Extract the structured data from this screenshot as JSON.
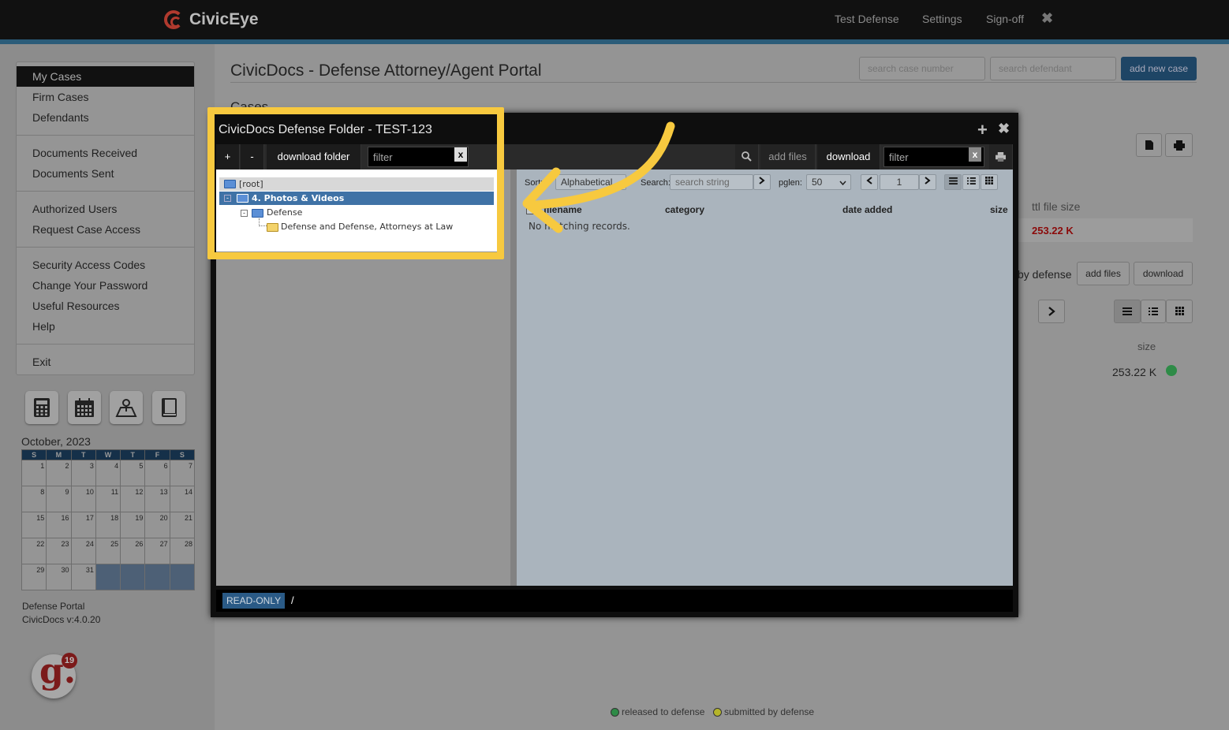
{
  "app": {
    "name": "CivicEye"
  },
  "topnav": {
    "items": [
      "Test Defense",
      "Settings",
      "Sign-off"
    ],
    "close": "✖"
  },
  "sidebar": {
    "items": [
      "My Cases",
      "Firm Cases",
      "Defendants",
      "Documents Received",
      "Documents Sent",
      "Authorized Users",
      "Request Case Access",
      "Security Access Codes",
      "Change Your Password",
      "Useful Resources",
      "Help",
      "Exit"
    ]
  },
  "calendar": {
    "title": "October, 2023",
    "days": [
      "S",
      "M",
      "T",
      "W",
      "T",
      "F",
      "S"
    ],
    "weeks": [
      [
        "1",
        "2",
        "3",
        "4",
        "5",
        "6",
        "7"
      ],
      [
        "8",
        "9",
        "10",
        "11",
        "12",
        "13",
        "14"
      ],
      [
        "15",
        "16",
        "17",
        "18",
        "19",
        "20",
        "21"
      ],
      [
        "22",
        "23",
        "24",
        "25",
        "26",
        "27",
        "28"
      ],
      [
        "29",
        "30",
        "31",
        "",
        "",
        "",
        ""
      ]
    ]
  },
  "portal_info": {
    "line1": "Defense Portal",
    "line2": "CivicDocs v:4.0.20"
  },
  "badge": {
    "letter": "g.",
    "count": "19"
  },
  "main": {
    "title": "CivicDocs - Defense Attorney/Agent Portal",
    "subtitle": "Cases",
    "search_case_placeholder": "search case number",
    "search_defendant_placeholder": "search defendant",
    "add_case_label": "add new case",
    "ttl_file_size_label": "ttl file size",
    "ttl_file_size_value": "253.22 K",
    "by_defense_label": "by defense",
    "add_files_label": "add files",
    "download_label": "download",
    "size_label": "size",
    "size_value": "253.22 K"
  },
  "legend": {
    "released": "released to defense",
    "submitted": "submitted by defense",
    "released_color": "#2e8b47",
    "submitted_color": "#b5b52a"
  },
  "modal": {
    "title": "CivicDocs Defense Folder - TEST-123",
    "toolbar": {
      "plus": "+",
      "minus": "-",
      "download_folder": "download folder",
      "filter_placeholder": "filter",
      "filter_clear": "x",
      "add_files": "add files",
      "download": "download",
      "filter2_placeholder": "filter",
      "filter2_clear": "x"
    },
    "tree": {
      "root": "[root]",
      "selected": "4. Photos & Videos",
      "child": "Defense",
      "grandchild": "Defense and Defense, Attorneys at Law"
    },
    "list": {
      "sort_label": "Sort:",
      "sort_value": "Alphabetical",
      "search_label": "Search:",
      "search_placeholder": "search string",
      "pglen_label": "pglen:",
      "pglen_value": "50",
      "page_value": "1",
      "columns": [
        "filename",
        "category",
        "date added",
        "size"
      ],
      "empty_message": "No matching records."
    },
    "status": {
      "mode": "READ-ONLY",
      "path": "/"
    }
  },
  "colors": {
    "highlight": "#f7c93f",
    "accent": "#2b5c79",
    "alert": "#8b0a0a"
  }
}
